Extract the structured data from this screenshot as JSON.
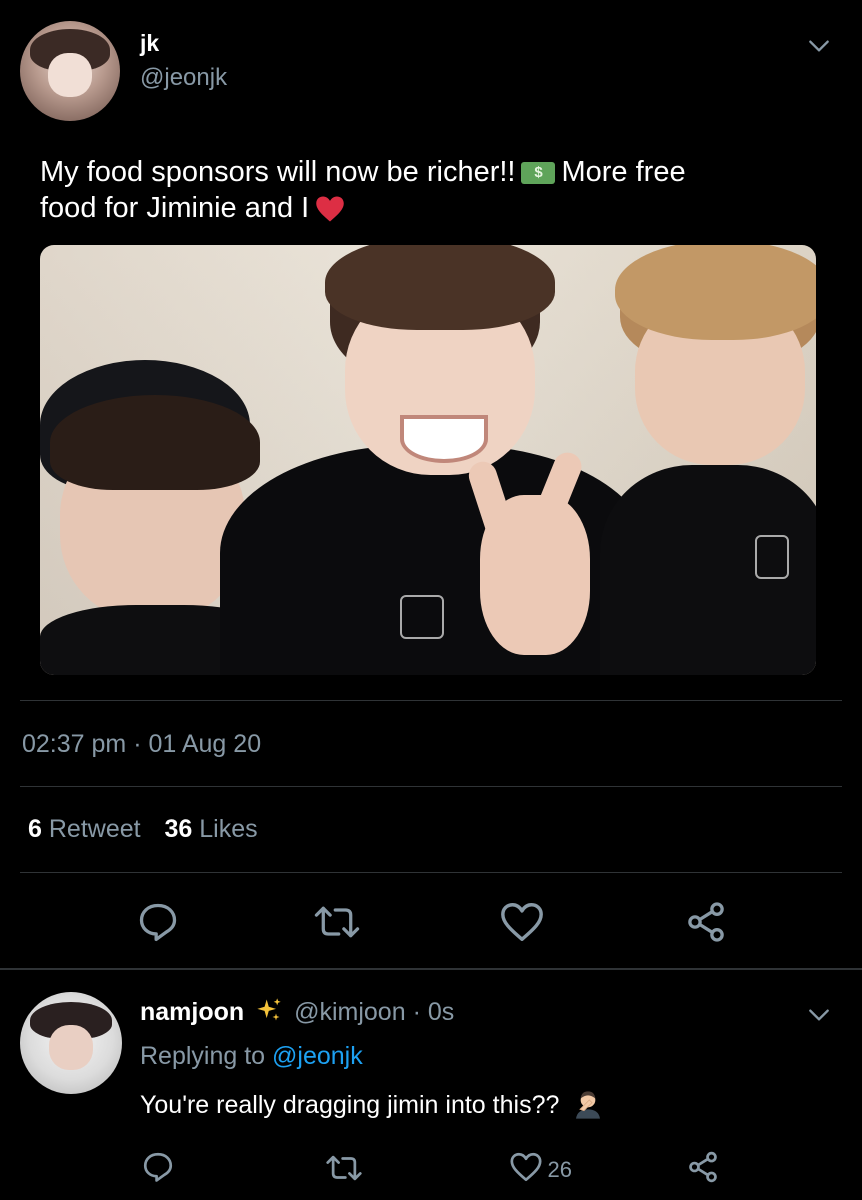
{
  "tweet": {
    "author": {
      "name": "jk",
      "handle": "@jeonjk",
      "avatar": "profile-photo"
    },
    "text_line1": "My food sponsors will now be richer!!",
    "text_line1_end": "More free",
    "text_line2": "food for Jiminie and I",
    "emoji": [
      "money-banknote-emoji",
      "red-heart-emoji"
    ],
    "money_emoji_glyph": "$",
    "image": "photo-of-three-people-one-making-peace-sign",
    "time": "02:37 pm",
    "separator": "·",
    "date": "01 Aug 20",
    "retweets_count": "6",
    "retweets_label": "Retweet",
    "likes_count": "36",
    "likes_label": "Likes",
    "actions": [
      "reply-icon",
      "retweet-icon",
      "like-icon",
      "share-icon"
    ]
  },
  "reply": {
    "author": {
      "name": "namjoon",
      "badge": "sparkles-emoji",
      "handle": "@kimjoon",
      "separator": "·",
      "time": "0s"
    },
    "replying_prefix": "Replying to",
    "replying_handle": "@jeonjk",
    "text": "You're really dragging jimin into this??",
    "text_emoji": "person-facepalming-emoji",
    "like_count": "26",
    "actions": [
      "reply-icon",
      "retweet-icon",
      "like-icon",
      "share-icon"
    ]
  },
  "colors": {
    "background": "#000000",
    "text": "#ffffff",
    "muted": "#8899a6",
    "link": "#1da1f2",
    "heart": "#e0245e",
    "divider": "#2f3336"
  }
}
